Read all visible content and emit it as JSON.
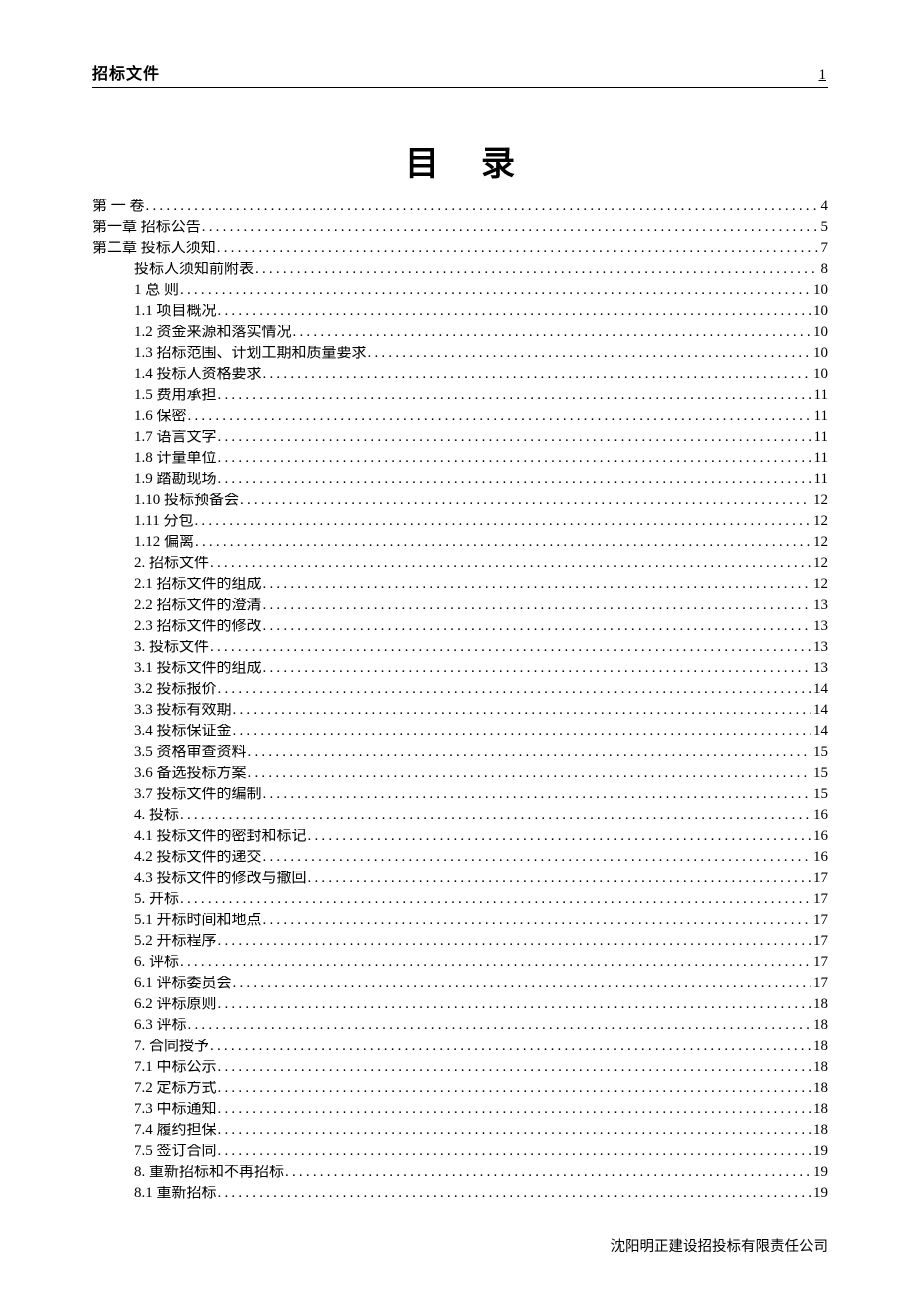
{
  "header": {
    "title": "招标文件",
    "pagenum": "1"
  },
  "title": "目录",
  "toc": [
    {
      "indent": 0,
      "label": "第 一 卷",
      "page": "4"
    },
    {
      "indent": 0,
      "label": "第一章 招标公告",
      "page": "5"
    },
    {
      "indent": 0,
      "label": "第二章 投标人须知",
      "page": "7"
    },
    {
      "indent": 1,
      "label": "投标人须知前附表",
      "page": "8"
    },
    {
      "indent": 1,
      "label": "1  总  则",
      "page": "10"
    },
    {
      "indent": 1,
      "label": "1.1 项目概况",
      "page": "10"
    },
    {
      "indent": 1,
      "label": "1.2 资金来源和落实情况",
      "page": "10"
    },
    {
      "indent": 1,
      "label": "1.3 招标范围、计划工期和质量要求",
      "page": "10"
    },
    {
      "indent": 1,
      "label": "1.4 投标人资格要求",
      "page": "10"
    },
    {
      "indent": 1,
      "label": "1.5 费用承担",
      "page": "11"
    },
    {
      "indent": 1,
      "label": "1.6 保密",
      "page": "11"
    },
    {
      "indent": 1,
      "label": "1.7 语言文字",
      "page": "11"
    },
    {
      "indent": 1,
      "label": "1.8 计量单位",
      "page": "11"
    },
    {
      "indent": 1,
      "label": "1.9 踏勘现场",
      "page": "11"
    },
    {
      "indent": 1,
      "label": "1.10 投标预备会",
      "page": "12"
    },
    {
      "indent": 1,
      "label": "1.11 分包",
      "page": "12"
    },
    {
      "indent": 1,
      "label": "1.12 偏离",
      "page": "12"
    },
    {
      "indent": 1,
      "label": "2. 招标文件",
      "page": "12"
    },
    {
      "indent": 1,
      "label": "2.1 招标文件的组成",
      "page": "12"
    },
    {
      "indent": 1,
      "label": "2.2 招标文件的澄清",
      "page": "13"
    },
    {
      "indent": 1,
      "label": "2.3 招标文件的修改",
      "page": "13"
    },
    {
      "indent": 1,
      "label": "3. 投标文件",
      "page": "13"
    },
    {
      "indent": 1,
      "label": "3.1 投标文件的组成",
      "page": "13"
    },
    {
      "indent": 1,
      "label": "3.2 投标报价",
      "page": "14"
    },
    {
      "indent": 1,
      "label": "3.3 投标有效期",
      "page": "14"
    },
    {
      "indent": 1,
      "label": "3.4 投标保证金",
      "page": "14"
    },
    {
      "indent": 1,
      "label": "3.5 资格审查资料",
      "page": "15"
    },
    {
      "indent": 1,
      "label": "3.6 备选投标方案",
      "page": "15"
    },
    {
      "indent": 1,
      "label": "3.7 投标文件的编制",
      "page": "15"
    },
    {
      "indent": 1,
      "label": "4. 投标",
      "page": "16"
    },
    {
      "indent": 1,
      "label": "4.1 投标文件的密封和标记",
      "page": "16"
    },
    {
      "indent": 1,
      "label": "4.2 投标文件的递交",
      "page": "16"
    },
    {
      "indent": 1,
      "label": "4.3 投标文件的修改与撤回",
      "page": "17"
    },
    {
      "indent": 1,
      "label": "5. 开标",
      "page": "17"
    },
    {
      "indent": 1,
      "label": "5.1 开标时间和地点",
      "page": "17"
    },
    {
      "indent": 1,
      "label": "5.2 开标程序",
      "page": "17"
    },
    {
      "indent": 1,
      "label": "6. 评标",
      "page": "17"
    },
    {
      "indent": 1,
      "label": "6.1 评标委员会",
      "page": "17"
    },
    {
      "indent": 1,
      "label": "6.2 评标原则",
      "page": "18"
    },
    {
      "indent": 1,
      "label": "6.3 评标",
      "page": "18"
    },
    {
      "indent": 1,
      "label": "7. 合同授予",
      "page": "18"
    },
    {
      "indent": 1,
      "label": "7.1 中标公示",
      "page": "18"
    },
    {
      "indent": 1,
      "label": "7.2 定标方式",
      "page": "18"
    },
    {
      "indent": 1,
      "label": "7.3 中标通知",
      "page": "18"
    },
    {
      "indent": 1,
      "label": "7.4 履约担保",
      "page": "18"
    },
    {
      "indent": 1,
      "label": "7.5 签订合同",
      "page": "19"
    },
    {
      "indent": 1,
      "label": "8. 重新招标和不再招标",
      "page": "19"
    },
    {
      "indent": 1,
      "label": "8.1 重新招标",
      "page": "19"
    }
  ],
  "footer": "沈阳明正建设招投标有限责任公司"
}
